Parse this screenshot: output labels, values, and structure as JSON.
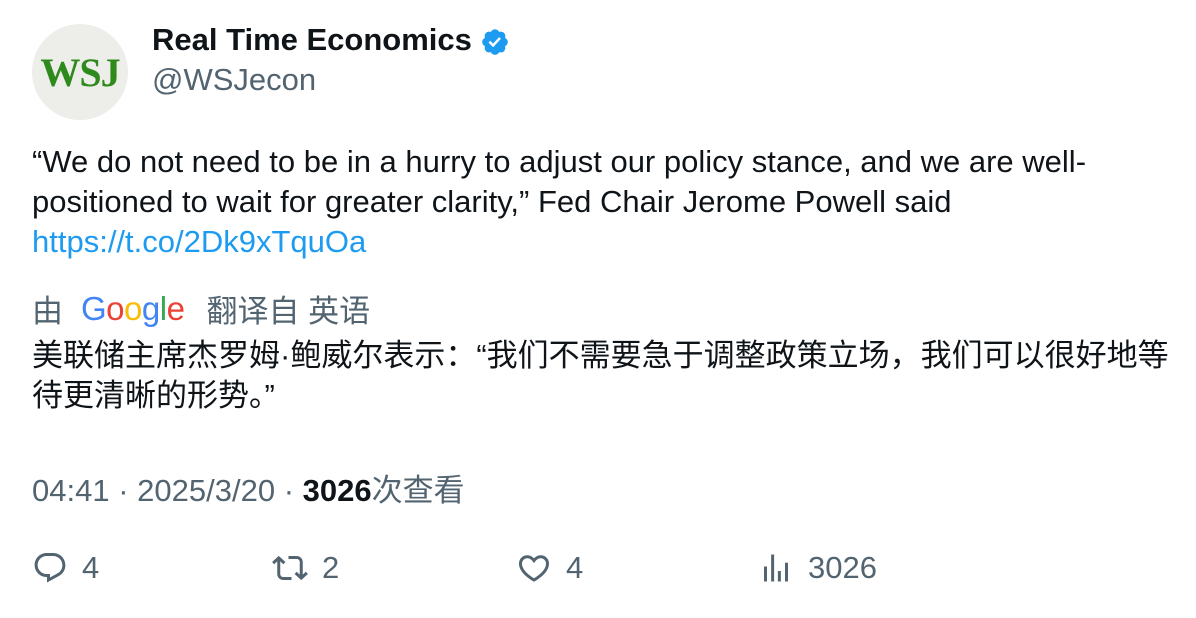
{
  "account": {
    "avatar_text": "WSJ",
    "display_name": "Real Time Economics",
    "handle": "@WSJecon",
    "verified_icon": "verified-badge-icon"
  },
  "tweet": {
    "text": "“We do not need to be in a hurry to adjust our policy stance, and we are well-positioned to wait for greater clarity,” Fed Chair Jerome Powell said",
    "link": "https://t.co/2Dk9xTquOa"
  },
  "translation": {
    "prefix": "由",
    "provider": "Google",
    "suffix": "翻译自 英语",
    "text": "美联储主席杰罗姆·鲍威尔表示：“我们不需要急于调整政策立场，我们可以很好地等待更清晰的形势。”"
  },
  "meta": {
    "time": "04:41",
    "sep1": "·",
    "date": "2025/3/20",
    "sep2": "·",
    "views_count": "3026",
    "views_label": "次查看"
  },
  "actions": {
    "replies": "4",
    "retweets": "2",
    "likes": "4",
    "views": "3026"
  },
  "colors": {
    "link": "#1d9bf0",
    "secondary": "#536471",
    "verified": "#1d9bf0",
    "wsj_green": "#2f8a1c"
  }
}
